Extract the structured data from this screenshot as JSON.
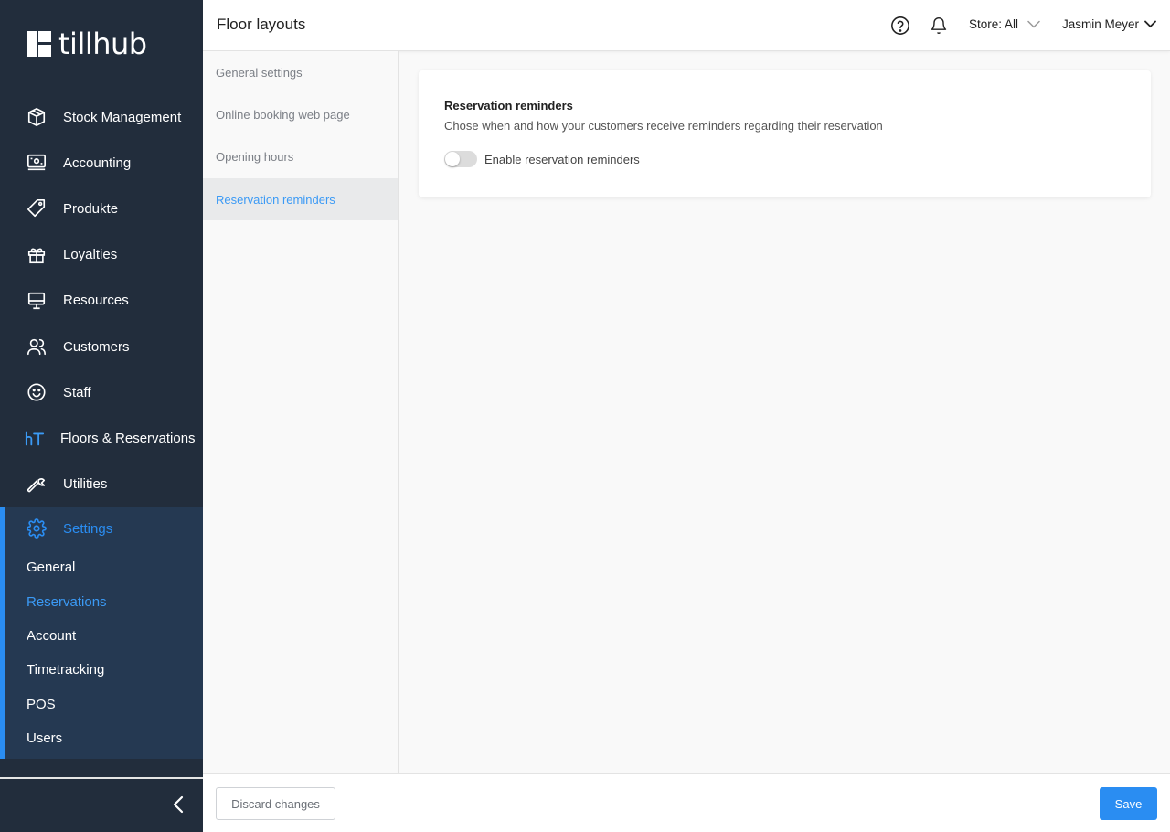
{
  "app": {
    "name": "tillhub"
  },
  "sidebar": {
    "items": [
      {
        "label": "Stock Management",
        "icon": "box-icon"
      },
      {
        "label": "Accounting",
        "icon": "cash-register-icon"
      },
      {
        "label": "Produkte",
        "icon": "tag-icon"
      },
      {
        "label": "Loyalties",
        "icon": "gift-icon"
      },
      {
        "label": "Resources",
        "icon": "monitor-icon"
      },
      {
        "label": "Customers",
        "icon": "users-icon"
      },
      {
        "label": "Staff",
        "icon": "smiley-icon"
      },
      {
        "label": "Floors & Reservations",
        "icon": "ht-icon"
      },
      {
        "label": "Utilities",
        "icon": "wrench-icon"
      }
    ],
    "settings": {
      "label": "Settings",
      "icon": "gear-icon",
      "sub_items": [
        {
          "label": "General"
        },
        {
          "label": "Reservations",
          "active": true
        },
        {
          "label": "Account"
        },
        {
          "label": "Timetracking"
        },
        {
          "label": "POS"
        },
        {
          "label": "Users"
        }
      ]
    }
  },
  "header": {
    "title": "Floor layouts",
    "store_label": "Store: All",
    "user_name": "Jasmin Meyer"
  },
  "subnav": {
    "items": [
      {
        "label": "General settings"
      },
      {
        "label": "Online booking web page"
      },
      {
        "label": "Opening hours"
      },
      {
        "label": "Reservation reminders",
        "active": true
      }
    ]
  },
  "card": {
    "title": "Reservation reminders",
    "description": "Chose when and how your customers receive reminders regarding their reservation",
    "toggle_label": "Enable reservation reminders",
    "toggle_on": false
  },
  "footer": {
    "discard_label": "Discard changes",
    "save_label": "Save"
  },
  "colors": {
    "sidebar_bg": "#222d3c",
    "settings_bg": "#253952",
    "accent": "#2a8df2"
  }
}
